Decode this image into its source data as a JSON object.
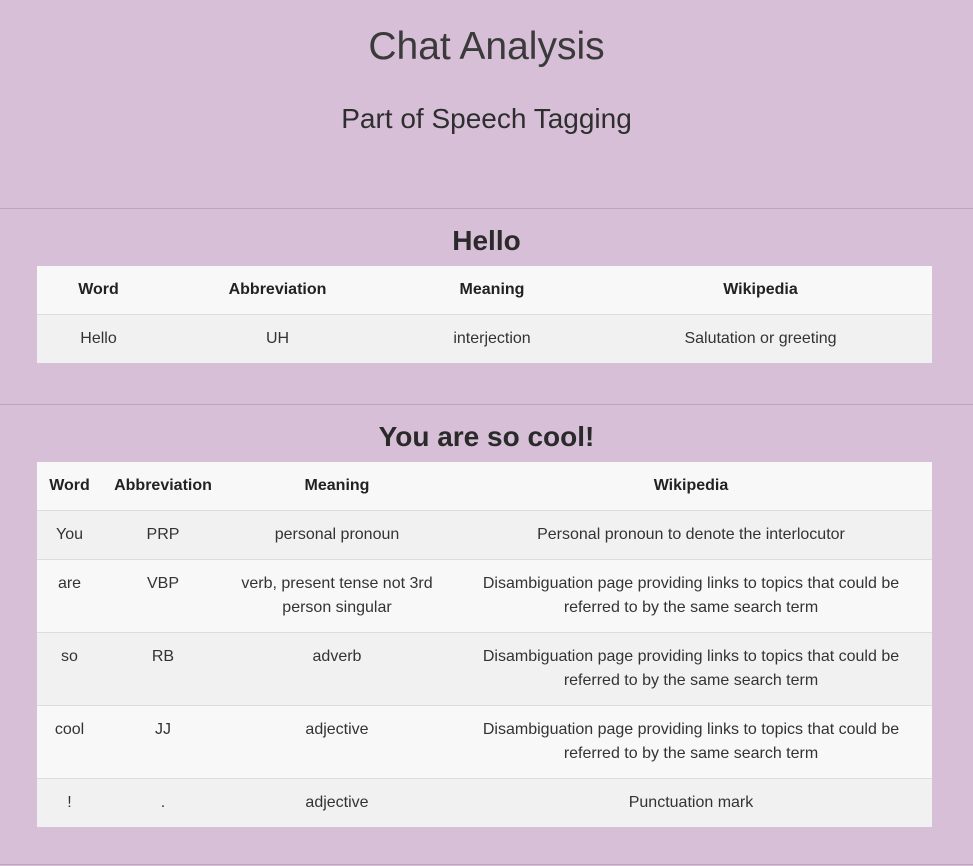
{
  "header": {
    "title": "Chat Analysis",
    "subtitle": "Part of Speech Tagging"
  },
  "columns": {
    "word": "Word",
    "abbreviation": "Abbreviation",
    "meaning": "Meaning",
    "wikipedia": "Wikipedia"
  },
  "sentences": [
    {
      "text": "Hello",
      "rows": [
        {
          "word": "Hello",
          "abbreviation": "UH",
          "meaning": "interjection",
          "wikipedia": "Salutation or greeting"
        }
      ]
    },
    {
      "text": "You are so cool!",
      "rows": [
        {
          "word": "You",
          "abbreviation": "PRP",
          "meaning": "personal pronoun",
          "wikipedia": "Personal pronoun to denote the interlocutor"
        },
        {
          "word": "are",
          "abbreviation": "VBP",
          "meaning": "verb, present tense not 3rd person singular",
          "wikipedia": "Disambiguation page providing links to topics that could be referred to by the same search term"
        },
        {
          "word": "so",
          "abbreviation": "RB",
          "meaning": "adverb",
          "wikipedia": "Disambiguation page providing links to topics that could be referred to by the same search term"
        },
        {
          "word": "cool",
          "abbreviation": "JJ",
          "meaning": "adjective",
          "wikipedia": "Disambiguation page providing links to topics that could be referred to by the same search term"
        },
        {
          "word": "!",
          "abbreviation": ".",
          "meaning": "adjective",
          "wikipedia": "Punctuation mark"
        }
      ]
    }
  ]
}
